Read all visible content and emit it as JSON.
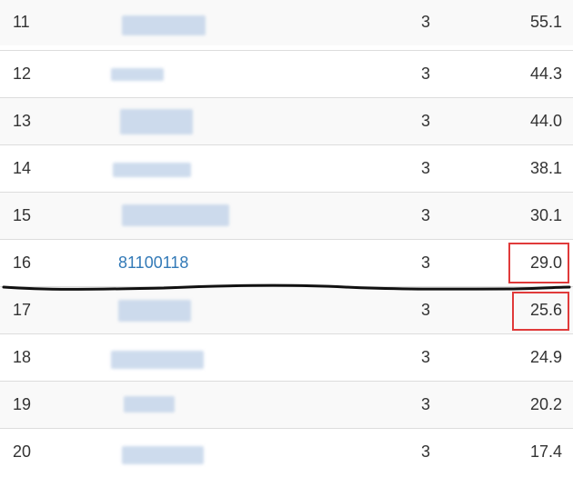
{
  "rows": [
    {
      "rank": "11",
      "id": "",
      "count": "3",
      "score": "55.1"
    },
    {
      "rank": "12",
      "id": "",
      "count": "3",
      "score": "44.3"
    },
    {
      "rank": "13",
      "id": "",
      "count": "3",
      "score": "44.0"
    },
    {
      "rank": "14",
      "id": "",
      "count": "3",
      "score": "38.1"
    },
    {
      "rank": "15",
      "id": "",
      "count": "3",
      "score": "30.1"
    },
    {
      "rank": "16",
      "id": "81100118",
      "count": "3",
      "score": "29.0"
    },
    {
      "rank": "17",
      "id": "",
      "count": "3",
      "score": "25.6"
    },
    {
      "rank": "18",
      "id": "",
      "count": "3",
      "score": "24.9"
    },
    {
      "rank": "19",
      "id": "",
      "count": "3",
      "score": "20.2"
    },
    {
      "rank": "20",
      "id": "",
      "count": "3",
      "score": "17.4"
    }
  ],
  "annotations": {
    "highlight_color": "#e03a3a",
    "divider_color": "#111111",
    "highlighted_scores": [
      "29.0",
      "25.6"
    ]
  },
  "colors": {
    "link": "#337ab7",
    "row_stripe": "#f9f9f9",
    "border": "#dddddd"
  }
}
